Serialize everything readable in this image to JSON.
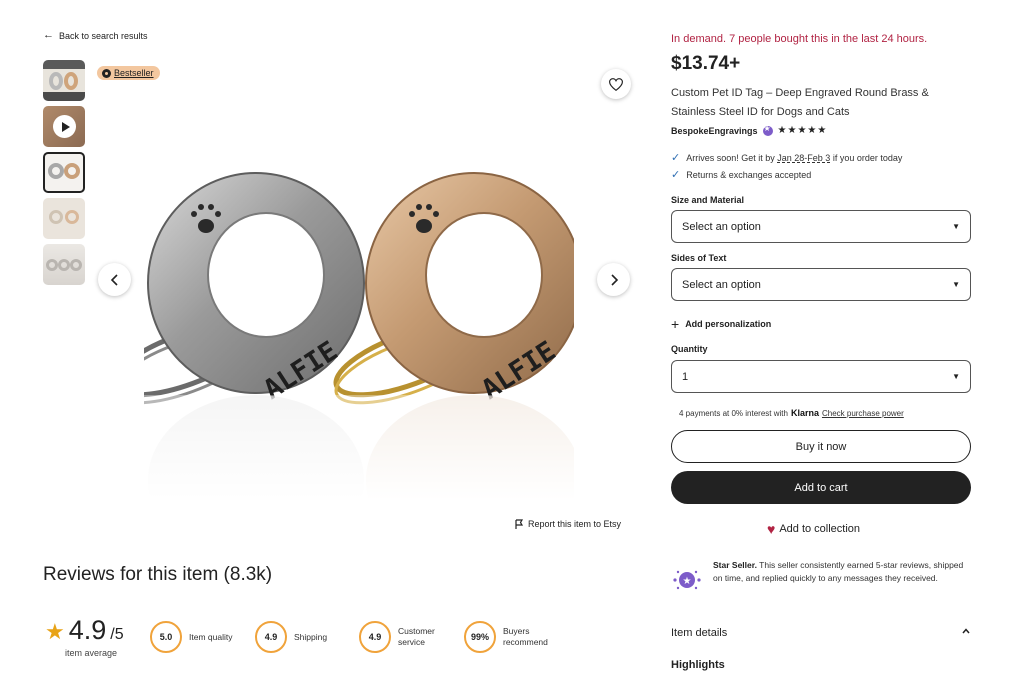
{
  "nav": {
    "back_label": "Back to search results"
  },
  "gallery": {
    "badge_label": "Bestseller",
    "thumbnails": [
      {
        "name": "thumb-1",
        "caption": "DEEP ENGRAVED"
      },
      {
        "name": "thumb-2-video"
      },
      {
        "name": "thumb-3"
      },
      {
        "name": "thumb-4"
      },
      {
        "name": "thumb-5"
      }
    ],
    "engraving_text": "ALFIE",
    "report_label": "Report this item to Etsy"
  },
  "reviews": {
    "title": "Reviews for this item (8.3k)",
    "average": "4.9",
    "out_of": "/5",
    "average_label": "item average",
    "metrics": [
      {
        "value": "5.0",
        "label": "Item quality"
      },
      {
        "value": "4.9",
        "label": "Shipping"
      },
      {
        "value": "4.9",
        "label": "Customer service"
      },
      {
        "value": "99%",
        "label": "Buyers recommend"
      }
    ]
  },
  "product": {
    "demand": "In demand. 7 people bought this in the last 24 hours.",
    "price": "$13.74+",
    "title": "Custom Pet ID Tag – Deep Engraved Round Brass & Stainless Steel ID for Dogs and Cats",
    "seller": "BespokeEngravings",
    "stars": "★★★★★",
    "arrival_prefix": "Arrives soon! Get it by",
    "arrival_dates": "Jan 28-Feb 3",
    "arrival_suffix": "if you order today",
    "returns": "Returns & exchanges accepted",
    "size_label": "Size and Material",
    "size_value": "Select an option",
    "sides_label": "Sides of Text",
    "sides_value": "Select an option",
    "add_personalization": "Add personalization",
    "quantity_label": "Quantity",
    "quantity_value": "1",
    "klarna_prefix": "4 payments at 0% interest with",
    "klarna_brand": "Klarna",
    "klarna_link": "Check purchase power",
    "buy_now": "Buy it now",
    "add_to_cart": "Add to cart",
    "add_to_collection": "Add to collection",
    "star_seller_title": "Star Seller.",
    "star_seller_text": "This seller consistently earned 5-star reviews, shipped on time, and replied quickly to any messages they received.",
    "item_details": "Item details",
    "highlights": "Highlights"
  },
  "colors": {
    "accent_red": "#b12343",
    "rating_orange": "#f0a33b",
    "star_purple": "#7d5cc9",
    "dark": "#222222"
  }
}
